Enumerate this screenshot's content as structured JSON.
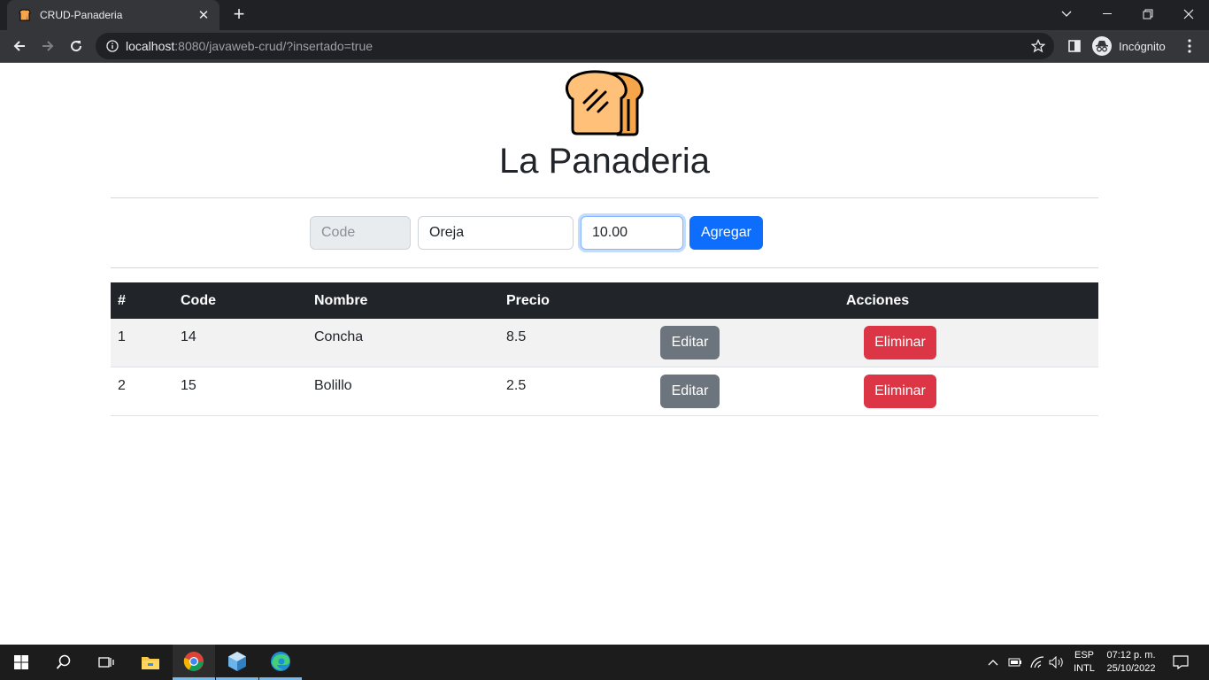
{
  "browser": {
    "tab_title": "CRUD-Panaderia",
    "url_host": "localhost",
    "url_rest": ":8080/javaweb-crud/?insertado=true",
    "profile_label": "Incógnito"
  },
  "page": {
    "title": "La Panaderia",
    "form": {
      "code_placeholder": "Code",
      "nombre_value": "Oreja",
      "precio_value": "10.00",
      "add_label": "Agregar"
    },
    "table": {
      "headers": [
        "#",
        "Code",
        "Nombre",
        "Precio",
        "Acciones"
      ],
      "rows": [
        {
          "num": "1",
          "code": "14",
          "nombre": "Concha",
          "precio": "8.5",
          "edit": "Editar",
          "delete": "Eliminar"
        },
        {
          "num": "2",
          "code": "15",
          "nombre": "Bolillo",
          "precio": "2.5",
          "edit": "Editar",
          "delete": "Eliminar"
        }
      ]
    }
  },
  "taskbar": {
    "lang_top": "ESP",
    "lang_bottom": "INTL",
    "time": "07:12 p. m.",
    "date": "25/10/2022"
  },
  "colors": {
    "primary": "#0d6efd",
    "secondary": "#6c757d",
    "danger": "#dc3545",
    "dark": "#212529"
  }
}
